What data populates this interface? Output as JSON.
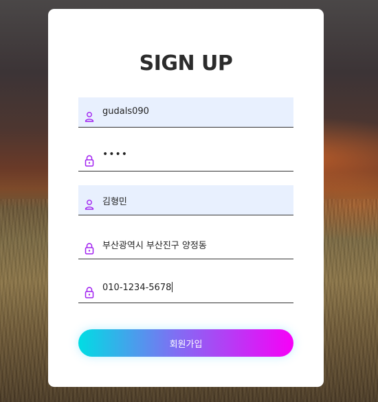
{
  "form": {
    "title": "SIGN UP",
    "fields": [
      {
        "name": "userid",
        "value": "gudals090",
        "icon": "user-icon",
        "autofilled": true
      },
      {
        "name": "password",
        "value": "••••",
        "icon": "lock-icon",
        "autofilled": false
      },
      {
        "name": "name",
        "value": "김형민",
        "icon": "user-icon",
        "autofilled": true
      },
      {
        "name": "address",
        "value": "부산광역시 부산진구 양정동",
        "icon": "lock-icon",
        "autofilled": false
      },
      {
        "name": "phone",
        "value": "010-1234-5678",
        "icon": "lock-icon",
        "autofilled": false
      }
    ],
    "submit_label": "회원가입"
  },
  "colors": {
    "icon": "#a020f0",
    "autofill_bg": "#e8f0fe",
    "button_gradient_start": "#00dde3",
    "button_gradient_end": "#f700f7",
    "title": "#2b2b2b"
  }
}
